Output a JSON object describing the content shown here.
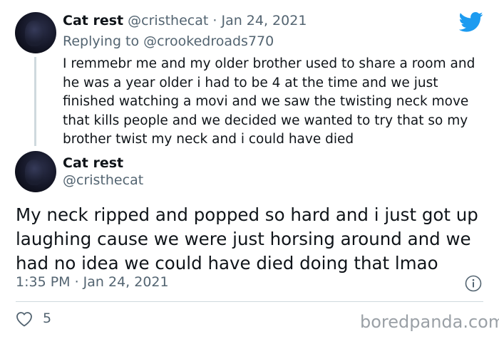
{
  "reply_tweet": {
    "display_name": "Cat rest",
    "handle": "@cristhecat",
    "separator": "·",
    "date": "Jan 24, 2021",
    "replying_to": "Replying to @crookedroads770",
    "text": "I remmebr me and my older brother used to share a room and he was a year older i had to be 4 at the time and we just finished watching a movi and we saw the twisting neck move that kills people and we decided we wanted to try that so my brother twist my neck and i could have died"
  },
  "main_tweet": {
    "display_name": "Cat rest",
    "handle": "@cristhecat",
    "text": "My neck ripped and popped so hard and i just got up laughing cause we were just horsing around and we had no idea we could have died doing that lmao",
    "timestamp": "1:35 PM · Jan 24, 2021",
    "likes": "5"
  },
  "icons": {
    "brand": "twitter-bird-icon",
    "info": "info-icon",
    "like": "heart-icon"
  },
  "colors": {
    "twitter_blue": "#1d9bf0",
    "text_primary": "#0f1419",
    "text_secondary": "#536471",
    "divider": "#cfd9de"
  },
  "watermark": "boredpanda.com"
}
